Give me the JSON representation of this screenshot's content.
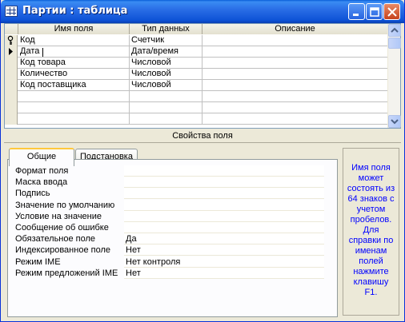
{
  "window": {
    "title": "Партии : таблица"
  },
  "grid": {
    "columns": [
      "Имя поля",
      "Тип данных",
      "Описание"
    ],
    "rows": [
      {
        "name": "Код",
        "type": "Счетчик",
        "desc": "",
        "key": true
      },
      {
        "name": "Дата",
        "type": "Дата/время",
        "desc": "",
        "current": true
      },
      {
        "name": "Код товара",
        "type": "Числовой",
        "desc": ""
      },
      {
        "name": "Количество",
        "type": "Числовой",
        "desc": ""
      },
      {
        "name": "Код поставщика",
        "type": "Числовой",
        "desc": ""
      },
      {
        "name": "",
        "type": "",
        "desc": ""
      },
      {
        "name": "",
        "type": "",
        "desc": ""
      },
      {
        "name": "",
        "type": "",
        "desc": ""
      }
    ]
  },
  "properties": {
    "title": "Свойства поля",
    "tabs": [
      "Общие",
      "Подстановка"
    ],
    "active_tab": "Общие",
    "rows": [
      {
        "label": "Формат поля",
        "value": ""
      },
      {
        "label": "Маска ввода",
        "value": ""
      },
      {
        "label": "Подпись",
        "value": ""
      },
      {
        "label": "Значение по умолчанию",
        "value": ""
      },
      {
        "label": "Условие на значение",
        "value": ""
      },
      {
        "label": "Сообщение об ошибке",
        "value": ""
      },
      {
        "label": "Обязательное поле",
        "value": "Да"
      },
      {
        "label": "Индексированное поле",
        "value": "Нет"
      },
      {
        "label": "Режим IME",
        "value": "Нет контроля"
      },
      {
        "label": "Режим предложений IME",
        "value": "Нет"
      }
    ],
    "help_text": "Имя поля может состоять из 64 знаков с учетом пробелов. Для справки по именам полей нажмите клавишу F1."
  },
  "colors": {
    "titlebar": "#0a5fd8",
    "help_text": "#0000ff",
    "face": "#ece9d8"
  },
  "icons": [
    "table-icon",
    "minimize-icon",
    "maximize-icon",
    "close-icon",
    "key-icon",
    "current-row-arrow-icon",
    "scroll-up-icon",
    "scroll-down-icon"
  ]
}
